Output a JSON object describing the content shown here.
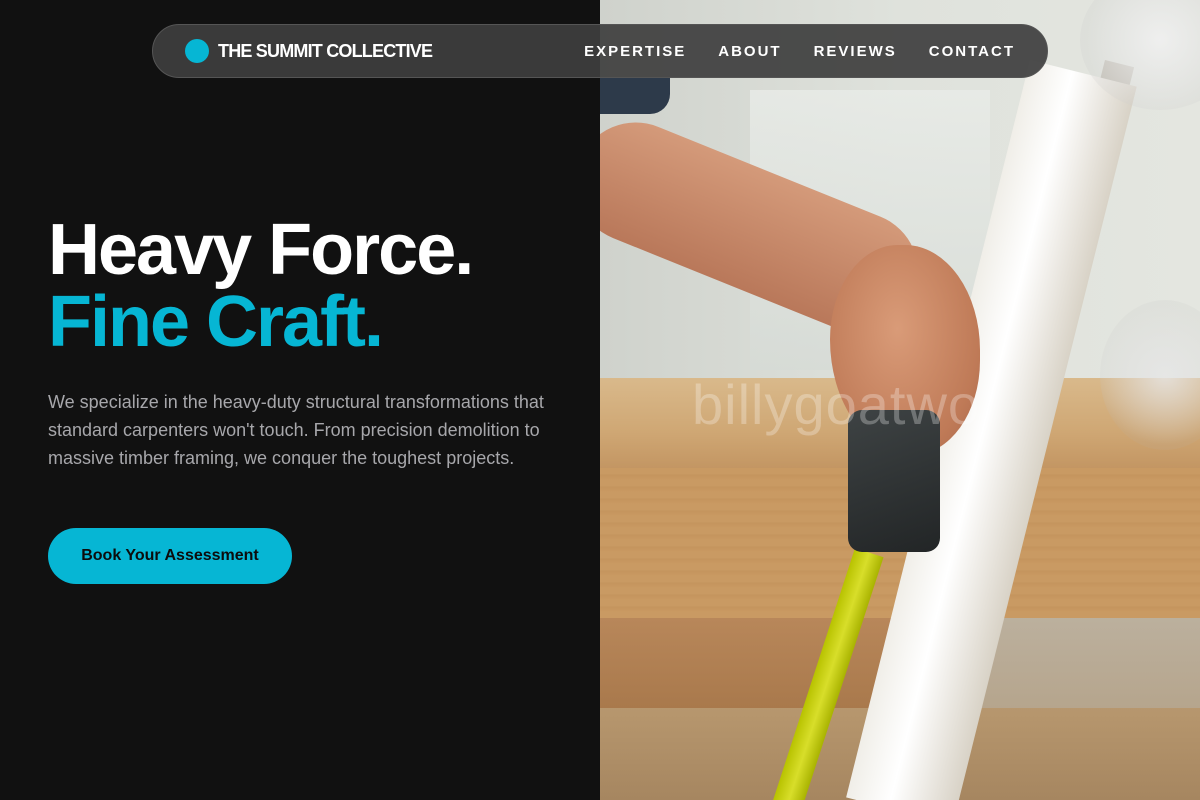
{
  "theme": {
    "accent": "#06b6d4",
    "background": "#111111",
    "text": "#ffffff",
    "muted_text": "#a7a7ab"
  },
  "navbar": {
    "brand_icon": "circle-logo-icon",
    "brand_name": "THE SUMMIT COLLECTIVE",
    "links": [
      "EXPERTISE",
      "ABOUT",
      "REVIEWS",
      "CONTACT"
    ]
  },
  "hero": {
    "headline_line1": "Heavy Force.",
    "headline_line2": "Fine Craft.",
    "description": "We specialize in the heavy-duty structural transformations that standard carpenters won't touch. From precision demolition to massive timber framing, we conquer the toughest projects.",
    "cta_label": "Book Your Assessment"
  },
  "photo": {
    "watermark": "billygoatwo"
  }
}
